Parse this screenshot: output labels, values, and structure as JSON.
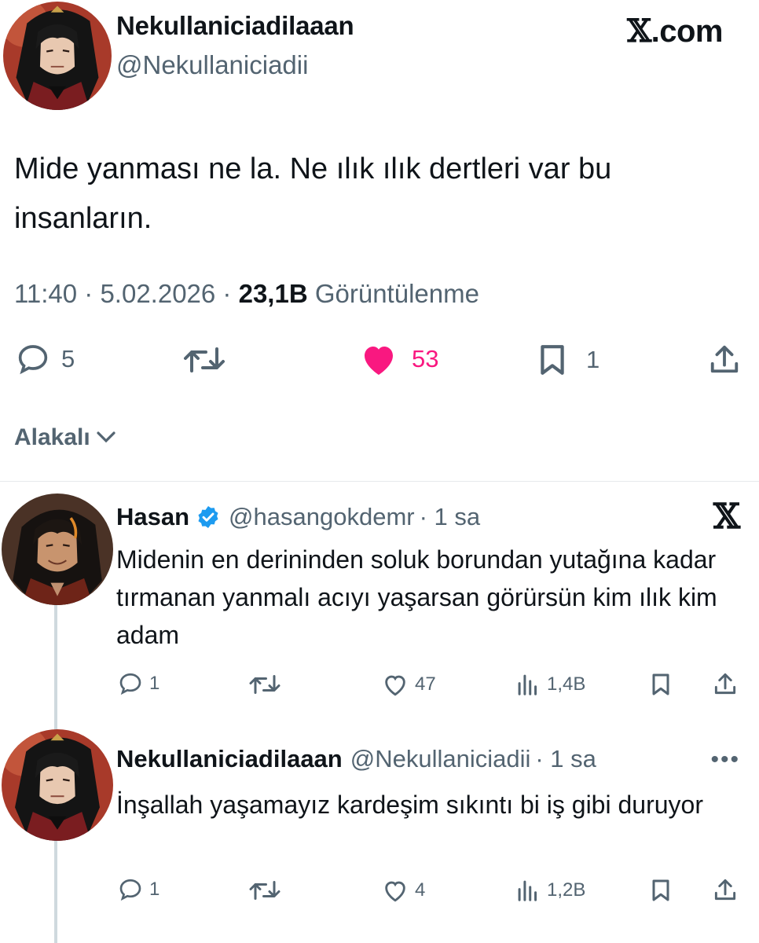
{
  "brand": {
    "text": ".com",
    "logo": "x-logo"
  },
  "tweet": {
    "name": "Nekullaniciadilaaan",
    "handle": "@Nekullaniciadii",
    "text": "Mide yanması ne la. Ne ılık ılık dertleri var bu insanların.",
    "time": "11:40 · 5.02.2026 · ",
    "views": "23,1B",
    "views_label": " Görüntülenme",
    "replies": "5",
    "likes": "53",
    "bookmarks": "1",
    "like_color": "#f91880"
  },
  "sort": {
    "label": "Alakalı"
  },
  "replies": [
    {
      "name": "Hasan",
      "handle": "@hasangokdemr",
      "dot_time": "· 1 sa",
      "verified": true,
      "text": "Midenin en derininden soluk borundan yutağına kadar tırmanan yanmalı acıyı yaşarsan görürsün kim ılık kim adam",
      "reply_count": "1",
      "like_count": "47",
      "view_count": "1,4B"
    },
    {
      "name": "Nekullaniciadilaaan",
      "handle": "@Nekullaniciadii",
      "dot_time": "· 1 sa",
      "verified": false,
      "text": "İnşallah yaşamayız kardeşim sıkıntı bi iş gibi duruyor",
      "reply_count": "1",
      "like_count": "4",
      "view_count": "1,2B"
    }
  ],
  "colors": {
    "secondary_text": "#536471",
    "verified_blue": "#1d9bf0",
    "divider": "#e6e9ec"
  }
}
